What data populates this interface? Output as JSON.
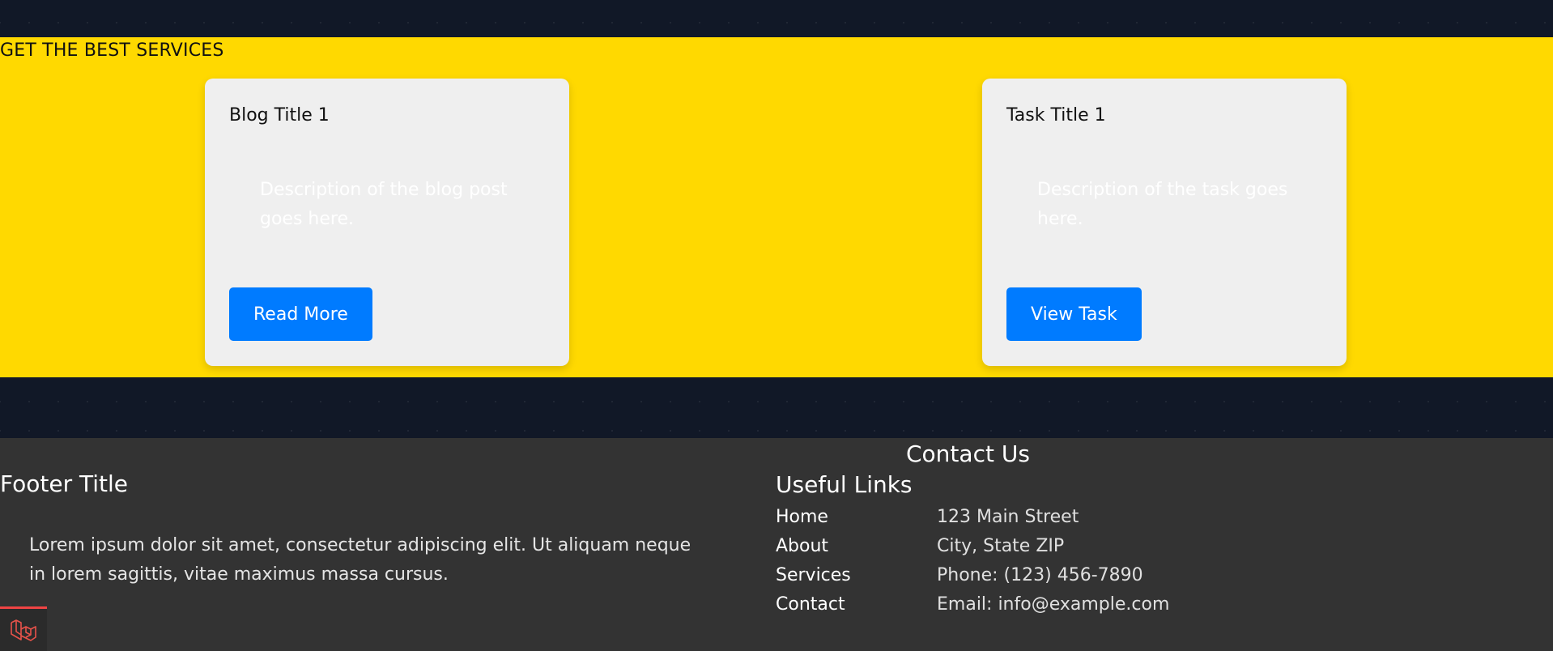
{
  "services": {
    "heading": "GET THE BEST SERVICES",
    "cards": [
      {
        "title": "Blog Title 1",
        "description": "Description of the blog post goes here.",
        "button": "Read More"
      },
      {
        "title": "Task Title 1",
        "description": "Description of the task goes here.",
        "button": "View Task"
      }
    ]
  },
  "footer": {
    "title": "Footer Title",
    "text": "Lorem ipsum dolor sit amet, consectetur adipiscing elit. Ut aliquam neque in lorem sagittis, vitae maximus massa cursus.",
    "links_title": "Useful Links",
    "links": [
      "Home",
      "About",
      "Services",
      "Contact"
    ],
    "contact_title": "Contact Us",
    "contact": [
      "123 Main Street",
      "City, State ZIP",
      "Phone: (123) 456-7890",
      "Email: info@example.com"
    ]
  },
  "badge": {
    "icon": "laravel-logo-icon"
  },
  "colors": {
    "page_bg": "#111827",
    "services_bg": "#ffd900",
    "card_bg": "#efefef",
    "button_bg": "#007bff",
    "footer_bg": "#333333",
    "badge_accent": "#ef4444"
  }
}
